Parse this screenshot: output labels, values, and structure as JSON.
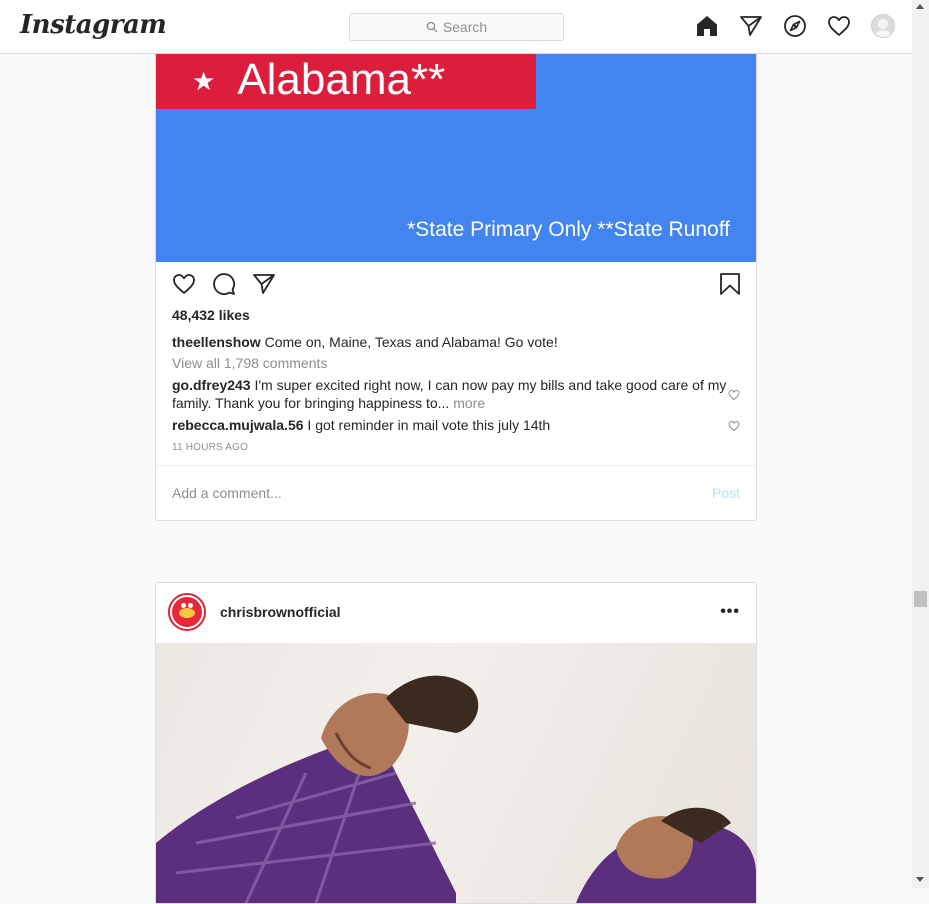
{
  "nav": {
    "logo": "Instagram",
    "search_placeholder": "Search",
    "icons": [
      "home-icon",
      "direct-icon",
      "explore-icon",
      "activity-heart-icon",
      "profile-avatar"
    ]
  },
  "post1": {
    "image": {
      "star": "★",
      "state": "Alabama**",
      "footnote": "*State Primary Only  **State Runoff",
      "colors": {
        "banner_red": "#dc1e3c",
        "background_blue": "#4285f0"
      }
    },
    "likes": "48,432 likes",
    "caption_user": "theellenshow",
    "caption_text": "Come on, Maine, Texas and Alabama! Go vote!",
    "view_all": "View all 1,798 comments",
    "comments": [
      {
        "user": "go.dfrey243",
        "text": "I'm super excited right now, I can now pay my bills and take good care of my family. Thank you for bringing happiness to...",
        "more": "more"
      },
      {
        "user": "rebecca.mujwala.56",
        "text": "I got reminder in mail vote this july 14th"
      }
    ],
    "timestamp": "11 HOURS AGO",
    "add_comment_placeholder": "Add a comment...",
    "post_button": "Post"
  },
  "post2": {
    "username": "chrisbrownofficial",
    "more": "•••"
  },
  "colors": {
    "link_blue_disabled": "#b2dffc",
    "muted": "#8e8e8e",
    "text": "#262626"
  }
}
